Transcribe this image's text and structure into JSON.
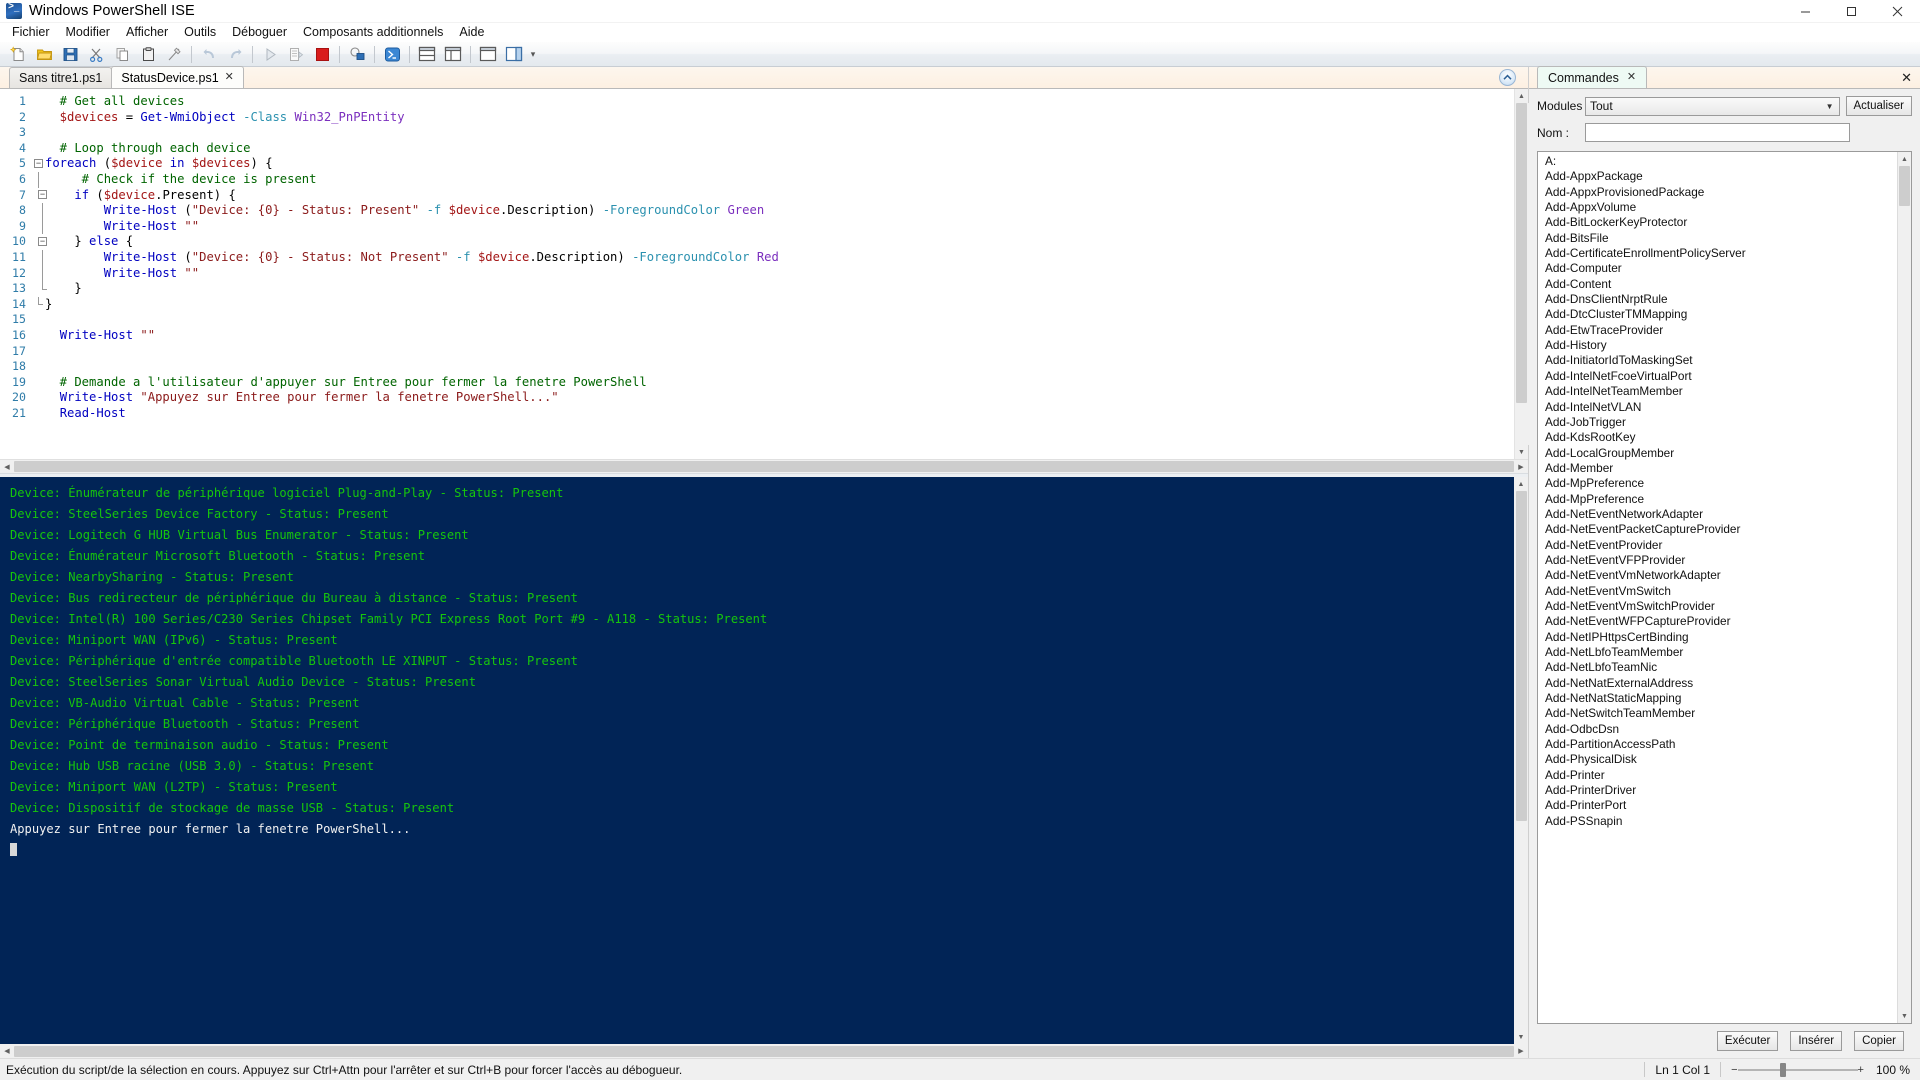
{
  "window": {
    "title": "Windows PowerShell ISE",
    "app_icon": "powershell-icon",
    "minimize": "–",
    "maximize": "❐",
    "close": "✕"
  },
  "menubar": {
    "items": [
      {
        "label": "Fichier"
      },
      {
        "label": "Modifier"
      },
      {
        "label": "Afficher"
      },
      {
        "label": "Outils"
      },
      {
        "label": "Déboguer"
      },
      {
        "label": "Composants additionnels"
      },
      {
        "label": "Aide"
      }
    ]
  },
  "toolbar": {
    "buttons": [
      {
        "name": "new-script-icon",
        "title": "Nouveau"
      },
      {
        "name": "open-folder-icon",
        "title": "Ouvrir"
      },
      {
        "name": "save-icon",
        "title": "Enregistrer"
      },
      {
        "name": "cut-scissors-icon",
        "title": "Couper"
      },
      {
        "name": "copy-icon",
        "title": "Copier"
      },
      {
        "name": "paste-clipboard-icon",
        "title": "Coller"
      },
      {
        "name": "clear-console-icon",
        "title": "Effacer"
      },
      {
        "name": "undo-arrow-icon",
        "title": "Annuler"
      },
      {
        "name": "redo-arrow-icon",
        "title": "Rétablir"
      },
      {
        "name": "run-script-icon",
        "title": "Exécuter le script"
      },
      {
        "name": "run-selection-icon",
        "title": "Exécuter la sélection"
      },
      {
        "name": "stop-square-icon",
        "title": "Arrêter l'opération"
      },
      {
        "name": "remote-session-icon",
        "title": "Nouvelle session distante"
      },
      {
        "name": "powershell-tab-icon",
        "title": "Nouvel onglet PowerShell"
      },
      {
        "name": "layout-top-bottom-icon",
        "title": "Afficher le volet Script en haut"
      },
      {
        "name": "layout-side-icon",
        "title": "Afficher le volet Script à droite"
      },
      {
        "name": "layout-maximize-icon",
        "title": "Afficher le volet Script maéimisé"
      },
      {
        "name": "show-commands-icon",
        "title": "Afficher le volet Commandes"
      },
      {
        "name": "toolbar-overflow-icon",
        "title": "Options"
      }
    ]
  },
  "script_tabs": {
    "tabs": [
      {
        "label": "Sans titre1.ps1",
        "active": false,
        "closable": false
      },
      {
        "label": "StatusDevice.ps1",
        "active": true,
        "closable": true,
        "close": "✕"
      }
    ],
    "collapse_icon": "chevron-up-icon"
  },
  "editor": {
    "lines": [
      {
        "num": 1,
        "fold": "",
        "tokens": [
          {
            "t": "cmt",
            "v": "  # Get all devices"
          }
        ]
      },
      {
        "num": 2,
        "fold": "",
        "tokens": [
          {
            "t": "var",
            "v": "  $devices"
          },
          {
            "t": "op",
            "v": " = "
          },
          {
            "t": "cmd",
            "v": "Get-WmiObject"
          },
          {
            "t": "op",
            "v": " "
          },
          {
            "t": "param",
            "v": "-Class"
          },
          {
            "t": "op",
            "v": " "
          },
          {
            "t": "type",
            "v": "Win32_PnPEntity"
          }
        ]
      },
      {
        "num": 3,
        "fold": "",
        "tokens": [
          {
            "t": "op",
            "v": ""
          }
        ]
      },
      {
        "num": 4,
        "fold": "",
        "tokens": [
          {
            "t": "cmt",
            "v": "  # Loop through each device"
          }
        ]
      },
      {
        "num": 5,
        "fold": "minus",
        "tokens": [
          {
            "t": "kw",
            "v": "foreach"
          },
          {
            "t": "op",
            "v": " ("
          },
          {
            "t": "var",
            "v": "$device"
          },
          {
            "t": "op",
            "v": " "
          },
          {
            "t": "kw",
            "v": "in"
          },
          {
            "t": "op",
            "v": " "
          },
          {
            "t": "var",
            "v": "$devices"
          },
          {
            "t": "op",
            "v": ") {"
          }
        ]
      },
      {
        "num": 6,
        "fold": "bar",
        "tokens": [
          {
            "t": "cmt",
            "v": "     # Check if the device is present"
          }
        ]
      },
      {
        "num": 7,
        "fold": "minus2",
        "tokens": [
          {
            "t": "op",
            "v": "    "
          },
          {
            "t": "kw",
            "v": "if"
          },
          {
            "t": "op",
            "v": " ("
          },
          {
            "t": "var",
            "v": "$device"
          },
          {
            "t": "op",
            "v": ".Present) {"
          }
        ]
      },
      {
        "num": 8,
        "fold": "bar2",
        "tokens": [
          {
            "t": "op",
            "v": "        "
          },
          {
            "t": "cmd",
            "v": "Write-Host"
          },
          {
            "t": "op",
            "v": " ("
          },
          {
            "t": "str",
            "v": "\"Device: {0} - Status: Present\""
          },
          {
            "t": "op",
            "v": " "
          },
          {
            "t": "param",
            "v": "-f"
          },
          {
            "t": "op",
            "v": " "
          },
          {
            "t": "var",
            "v": "$device"
          },
          {
            "t": "op",
            "v": ".Description) "
          },
          {
            "t": "param",
            "v": "-ForegroundColor"
          },
          {
            "t": "op",
            "v": " "
          },
          {
            "t": "type",
            "v": "Green"
          }
        ]
      },
      {
        "num": 9,
        "fold": "bar2",
        "tokens": [
          {
            "t": "op",
            "v": "        "
          },
          {
            "t": "cmd",
            "v": "Write-Host"
          },
          {
            "t": "op",
            "v": " "
          },
          {
            "t": "str",
            "v": "\"\""
          }
        ]
      },
      {
        "num": 10,
        "fold": "minus2",
        "tokens": [
          {
            "t": "op",
            "v": "    } "
          },
          {
            "t": "kw",
            "v": "else"
          },
          {
            "t": "op",
            "v": " {"
          }
        ]
      },
      {
        "num": 11,
        "fold": "bar2",
        "tokens": [
          {
            "t": "op",
            "v": "        "
          },
          {
            "t": "cmd",
            "v": "Write-Host"
          },
          {
            "t": "op",
            "v": " ("
          },
          {
            "t": "str",
            "v": "\"Device: {0} - Status: Not Present\""
          },
          {
            "t": "op",
            "v": " "
          },
          {
            "t": "param",
            "v": "-f"
          },
          {
            "t": "op",
            "v": " "
          },
          {
            "t": "var",
            "v": "$device"
          },
          {
            "t": "op",
            "v": ".Description) "
          },
          {
            "t": "param",
            "v": "-ForegroundColor"
          },
          {
            "t": "op",
            "v": " "
          },
          {
            "t": "type",
            "v": "Red"
          }
        ]
      },
      {
        "num": 12,
        "fold": "bar2",
        "tokens": [
          {
            "t": "op",
            "v": "        "
          },
          {
            "t": "cmd",
            "v": "Write-Host"
          },
          {
            "t": "op",
            "v": " "
          },
          {
            "t": "str",
            "v": "\"\""
          }
        ]
      },
      {
        "num": 13,
        "fold": "bar2e",
        "tokens": [
          {
            "t": "op",
            "v": "    }"
          }
        ]
      },
      {
        "num": 14,
        "fold": "bare",
        "tokens": [
          {
            "t": "op",
            "v": "}"
          }
        ]
      },
      {
        "num": 15,
        "fold": "",
        "tokens": [
          {
            "t": "op",
            "v": ""
          }
        ]
      },
      {
        "num": 16,
        "fold": "",
        "tokens": [
          {
            "t": "op",
            "v": "  "
          },
          {
            "t": "cmd",
            "v": "Write-Host"
          },
          {
            "t": "op",
            "v": " "
          },
          {
            "t": "str",
            "v": "\"\""
          }
        ]
      },
      {
        "num": 17,
        "fold": "",
        "tokens": [
          {
            "t": "op",
            "v": ""
          }
        ]
      },
      {
        "num": 18,
        "fold": "",
        "tokens": [
          {
            "t": "op",
            "v": ""
          }
        ]
      },
      {
        "num": 19,
        "fold": "",
        "tokens": [
          {
            "t": "cmt",
            "v": "  # Demande a l'utilisateur d'appuyer sur Entree pour fermer la fenetre PowerShell"
          }
        ]
      },
      {
        "num": 20,
        "fold": "",
        "tokens": [
          {
            "t": "op",
            "v": "  "
          },
          {
            "t": "cmd",
            "v": "Write-Host"
          },
          {
            "t": "op",
            "v": " "
          },
          {
            "t": "str",
            "v": "\"Appuyez sur Entree pour fermer la fenetre PowerShell...\""
          }
        ]
      },
      {
        "num": 21,
        "fold": "",
        "tokens": [
          {
            "t": "op",
            "v": "  "
          },
          {
            "t": "cmd",
            "v": "Read-Host"
          }
        ]
      }
    ]
  },
  "console": {
    "lines": [
      {
        "text": "Device: Énumérateur de périphérique logiciel Plug-and-Play - Status: Present",
        "color": "green"
      },
      {
        "text": "Device: SteelSeries Device Factory - Status: Present",
        "color": "green"
      },
      {
        "text": "Device: Logitech G HUB Virtual Bus Enumerator - Status: Present",
        "color": "green"
      },
      {
        "text": "Device: Énumérateur Microsoft Bluetooth - Status: Present",
        "color": "green"
      },
      {
        "text": "Device: NearbySharing - Status: Present",
        "color": "green"
      },
      {
        "text": "Device: Bus redirecteur de périphérique du Bureau à distance - Status: Present",
        "color": "green"
      },
      {
        "text": "Device: Intel(R) 100 Series/C230 Series Chipset Family PCI Express Root Port #9 - A118 - Status: Present",
        "color": "green"
      },
      {
        "text": "Device: Miniport WAN (IPv6) - Status: Present",
        "color": "green"
      },
      {
        "text": "Device: Périphérique d'entrée compatible Bluetooth LE XINPUT - Status: Present",
        "color": "green"
      },
      {
        "text": "Device: SteelSeries Sonar Virtual Audio Device - Status: Present",
        "color": "green"
      },
      {
        "text": "Device: VB-Audio Virtual Cable - Status: Present",
        "color": "green"
      },
      {
        "text": "Device: Périphérique Bluetooth - Status: Present",
        "color": "green"
      },
      {
        "text": "Device: Point de terminaison audio - Status: Present",
        "color": "green"
      },
      {
        "text": "Device: Hub USB racine (USB 3.0) - Status: Present",
        "color": "green"
      },
      {
        "text": "Device: Miniport WAN (L2TP) - Status: Present",
        "color": "green"
      },
      {
        "text": "Device: Dispositif de stockage de masse USB - Status: Present",
        "color": "green"
      },
      {
        "text": "",
        "color": "green"
      },
      {
        "text": "Appuyez sur Entree pour fermer la fenetre PowerShell...",
        "color": "white"
      }
    ]
  },
  "commands_pane": {
    "tab_label": "Commandes",
    "tab_close": "✕",
    "pane_close": "✕",
    "modules_label": "Modules",
    "modules_value": "Tout",
    "refresh_label": "Actualiser",
    "name_label": "Nom :",
    "name_value": "",
    "list_header": "A:",
    "items": [
      "Add-AppxPackage",
      "Add-AppxProvisionedPackage",
      "Add-AppxVolume",
      "Add-BitLockerKeyProtector",
      "Add-BitsFile",
      "Add-CertificateEnrollmentPolicyServer",
      "Add-Computer",
      "Add-Content",
      "Add-DnsClientNrptRule",
      "Add-DtcClusterTMMapping",
      "Add-EtwTraceProvider",
      "Add-History",
      "Add-InitiatorIdToMaskingSet",
      "Add-IntelNetFcoeVirtualPort",
      "Add-IntelNetTeamMember",
      "Add-IntelNetVLAN",
      "Add-JobTrigger",
      "Add-KdsRootKey",
      "Add-LocalGroupMember",
      "Add-Member",
      "Add-MpPreference",
      "Add-MpPreference",
      "Add-NetEventNetworkAdapter",
      "Add-NetEventPacketCaptureProvider",
      "Add-NetEventProvider",
      "Add-NetEventVFPProvider",
      "Add-NetEventVmNetworkAdapter",
      "Add-NetEventVmSwitch",
      "Add-NetEventVmSwitchProvider",
      "Add-NetEventWFPCaptureProvider",
      "Add-NetIPHttpsCertBinding",
      "Add-NetLbfoTeamMember",
      "Add-NetLbfoTeamNic",
      "Add-NetNatExternalAddress",
      "Add-NetNatStaticMapping",
      "Add-NetSwitchTeamMember",
      "Add-OdbcDsn",
      "Add-PartitionAccessPath",
      "Add-PhysicalDisk",
      "Add-Printer",
      "Add-PrinterDriver",
      "Add-PrinterPort",
      "Add-PSSnapin"
    ],
    "footer_buttons": [
      {
        "label": "Exécuter",
        "name": "run-button"
      },
      {
        "label": "Insérer",
        "name": "insert-button"
      },
      {
        "label": "Copier",
        "name": "copy-button"
      }
    ]
  },
  "statusbar": {
    "message": "Exécution du script/de la sélection en cours. Appuyez sur Ctrl+Attn pour l'arrêter et sur Ctrl+B pour forcer l'accès au débogueur.",
    "line_col": "Ln 1  Col 1",
    "zoom": "100 %",
    "zoom_minus": "−",
    "zoom_plus": "+"
  }
}
